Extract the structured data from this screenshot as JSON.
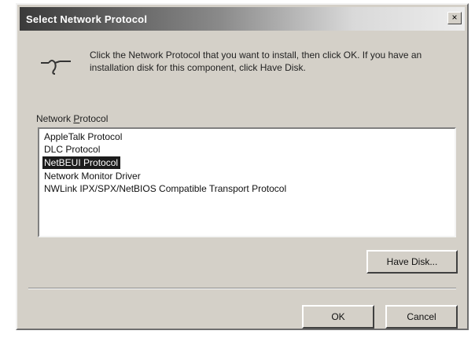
{
  "window": {
    "title": "Select Network Protocol",
    "close_label": "×"
  },
  "instructions": "Click the Network Protocol that you want to install, then click OK. If you have an installation disk for this component, click Have Disk.",
  "list": {
    "label_prefix": "Network ",
    "label_underlined": "P",
    "label_suffix": "rotocol",
    "items": [
      "AppleTalk Protocol",
      "DLC Protocol",
      "NetBEUI Protocol",
      "Network Monitor Driver",
      "NWLink IPX/SPX/NetBIOS Compatible Transport Protocol"
    ],
    "selected_index": 2
  },
  "buttons": {
    "have_disk": "Have Disk...",
    "ok": "OK",
    "cancel": "Cancel"
  },
  "icons": {
    "header": "network-protocol-icon",
    "close": "close-icon"
  },
  "colors": {
    "selection_bg": "#1c1c1c",
    "dialog_bg": "#d4d0c8"
  }
}
